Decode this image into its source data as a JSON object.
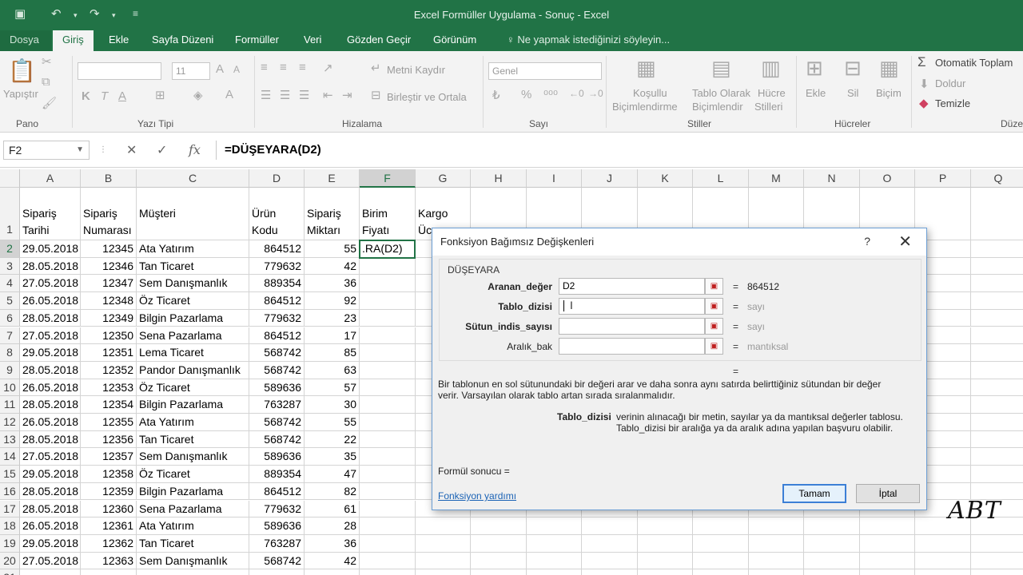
{
  "window": {
    "title": "Excel Formüller Uygulama - Sonuç - Excel"
  },
  "tabs": [
    "Dosya",
    "Giriş",
    "Ekle",
    "Sayfa Düzeni",
    "Formüller",
    "Veri",
    "Gözden Geçir",
    "Görünüm"
  ],
  "tell_me": "Ne yapmak istediğinizi söyleyin...",
  "ribbon": {
    "paste": "Yapıştır",
    "font_size": "11",
    "bold": "K",
    "italic": "T",
    "underline": "A",
    "wrap_text": "Metni Kaydır",
    "merge_center": "Birleştir ve Ortala",
    "number_format": "Genel",
    "conditional_1": "Koşullu",
    "conditional_2": "Biçimlendirme",
    "table_1": "Tablo Olarak",
    "table_2": "Biçimlendir",
    "styles_1": "Hücre",
    "styles_2": "Stilleri",
    "insert": "Ekle",
    "delete": "Sil",
    "format": "Biçim",
    "autosum": "Otomatik Toplam",
    "fill": "Doldur",
    "clear": "Temizle",
    "groups": [
      "Pano",
      "Yazı Tipi",
      "Hizalama",
      "Sayı",
      "Stiller",
      "Hücreler",
      "Düze"
    ]
  },
  "formula_bar": {
    "name_box": "F2",
    "formula": "=DÜŞEYARA(D2)"
  },
  "columns": [
    "A",
    "B",
    "C",
    "D",
    "E",
    "F",
    "G",
    "H",
    "I",
    "J",
    "K",
    "L",
    "M",
    "N",
    "O",
    "P",
    "Q"
  ],
  "header_row": {
    "A": [
      "Sipariş",
      "Tarihi"
    ],
    "B": [
      "Sipariş",
      "Numarası"
    ],
    "C": [
      "",
      "Müşteri"
    ],
    "D": [
      "Ürün",
      "Kodu"
    ],
    "E": [
      "Sipariş",
      "Miktarı"
    ],
    "F": [
      "Birim",
      "Fiyatı"
    ],
    "G": [
      "Kargo",
      "Üc"
    ]
  },
  "active_cell_text": ".RA(D2)",
  "rows": [
    [
      "29.05.2018",
      "12345",
      "Ata Yatırım",
      "864512",
      "55"
    ],
    [
      "28.05.2018",
      "12346",
      "Tan Ticaret",
      "779632",
      "42"
    ],
    [
      "27.05.2018",
      "12347",
      "Sem Danışmanlık",
      "889354",
      "36"
    ],
    [
      "26.05.2018",
      "12348",
      "Öz Ticaret",
      "864512",
      "92"
    ],
    [
      "28.05.2018",
      "12349",
      "Bilgin Pazarlama",
      "779632",
      "23"
    ],
    [
      "27.05.2018",
      "12350",
      "Sena Pazarlama",
      "864512",
      "17"
    ],
    [
      "29.05.2018",
      "12351",
      "Lema Ticaret",
      "568742",
      "85"
    ],
    [
      "28.05.2018",
      "12352",
      "Pandor Danışmanlık",
      "568742",
      "63"
    ],
    [
      "26.05.2018",
      "12353",
      "Öz Ticaret",
      "589636",
      "57"
    ],
    [
      "28.05.2018",
      "12354",
      "Bilgin Pazarlama",
      "763287",
      "30"
    ],
    [
      "26.05.2018",
      "12355",
      "Ata Yatırım",
      "568742",
      "55"
    ],
    [
      "28.05.2018",
      "12356",
      "Tan Ticaret",
      "568742",
      "22"
    ],
    [
      "27.05.2018",
      "12357",
      "Sem Danışmanlık",
      "589636",
      "35"
    ],
    [
      "29.05.2018",
      "12358",
      "Öz Ticaret",
      "889354",
      "47"
    ],
    [
      "28.05.2018",
      "12359",
      "Bilgin Pazarlama",
      "864512",
      "82"
    ],
    [
      "28.05.2018",
      "12360",
      "Sena Pazarlama",
      "779632",
      "61"
    ],
    [
      "26.05.2018",
      "12361",
      "Ata Yatırım",
      "589636",
      "28"
    ],
    [
      "29.05.2018",
      "12362",
      "Tan Ticaret",
      "763287",
      "36"
    ],
    [
      "27.05.2018",
      "12363",
      "Sem Danışmanlık",
      "568742",
      "42"
    ]
  ],
  "dialog": {
    "title": "Fonksiyon Bağımsız Değişkenleri",
    "help": "?",
    "close": "✕",
    "function_name": "DÜŞEYARA",
    "args": [
      {
        "label": "Aranan_değer",
        "value": "D2",
        "result": "864512",
        "muted": false,
        "bold": true
      },
      {
        "label": "Tablo_dizisi",
        "value": "",
        "result": "sayı",
        "muted": true,
        "bold": true
      },
      {
        "label": "Sütun_indis_sayısı",
        "value": "",
        "result": "sayı",
        "muted": true,
        "bold": true
      },
      {
        "label": "Aralık_bak",
        "value": "",
        "result": "mantıksal",
        "muted": true,
        "bold": false
      }
    ],
    "eq": "=",
    "description_1": "Bir tablonun en sol sütunundaki bir değeri arar ve daha sonra aynı satırda belirttiğiniz sütundan bir değer",
    "description_2": "verir. Varsayılan olarak tablo artan sırada sıralanmalıdır.",
    "arg_name": "Tablo_dizisi",
    "arg_desc_1": "verinin alınacağı bir metin, sayılar ya da mantıksal değerler tablosu.",
    "arg_desc_2": "Tablo_dizisi bir aralığa ya da aralık adına yapılan başvuru olabilir.",
    "formula_result": "Formül sonucu =",
    "help_link": "Fonksiyon yardımı",
    "ok": "Tamam",
    "cancel": "İptal"
  },
  "watermark": "ABT"
}
